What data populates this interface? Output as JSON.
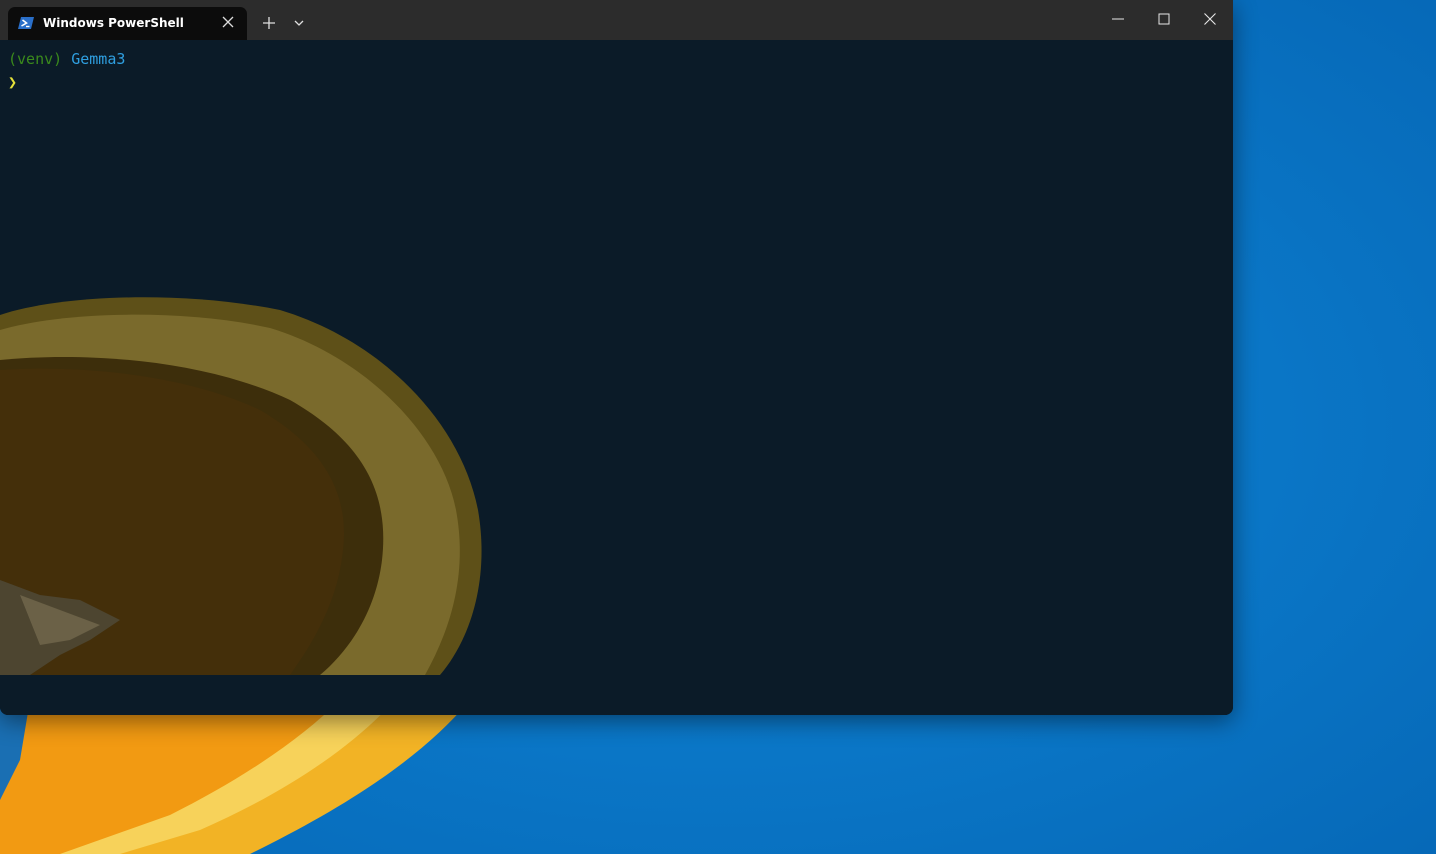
{
  "window": {
    "tab_title": "Windows PowerShell",
    "tab_icon": "powershell-icon",
    "controls": {
      "new_tab": "plus-icon",
      "dropdown": "chevron-down-icon",
      "minimize": "minimize-icon",
      "maximize": "maximize-icon",
      "close": "close-icon"
    }
  },
  "terminal": {
    "line1": {
      "venv": "(venv)",
      "directory": "Gemma3"
    },
    "prompt": "❯"
  },
  "colors": {
    "titlebar": "#2c2c2c",
    "tab_active": "#0c0c0c",
    "terminal_background": "#0b1b28",
    "desktop_background": "#0a7bd1",
    "venv_text": "#3a8a1c",
    "directory_text": "#2f9fe0",
    "prompt_char": "#e6e23a"
  }
}
